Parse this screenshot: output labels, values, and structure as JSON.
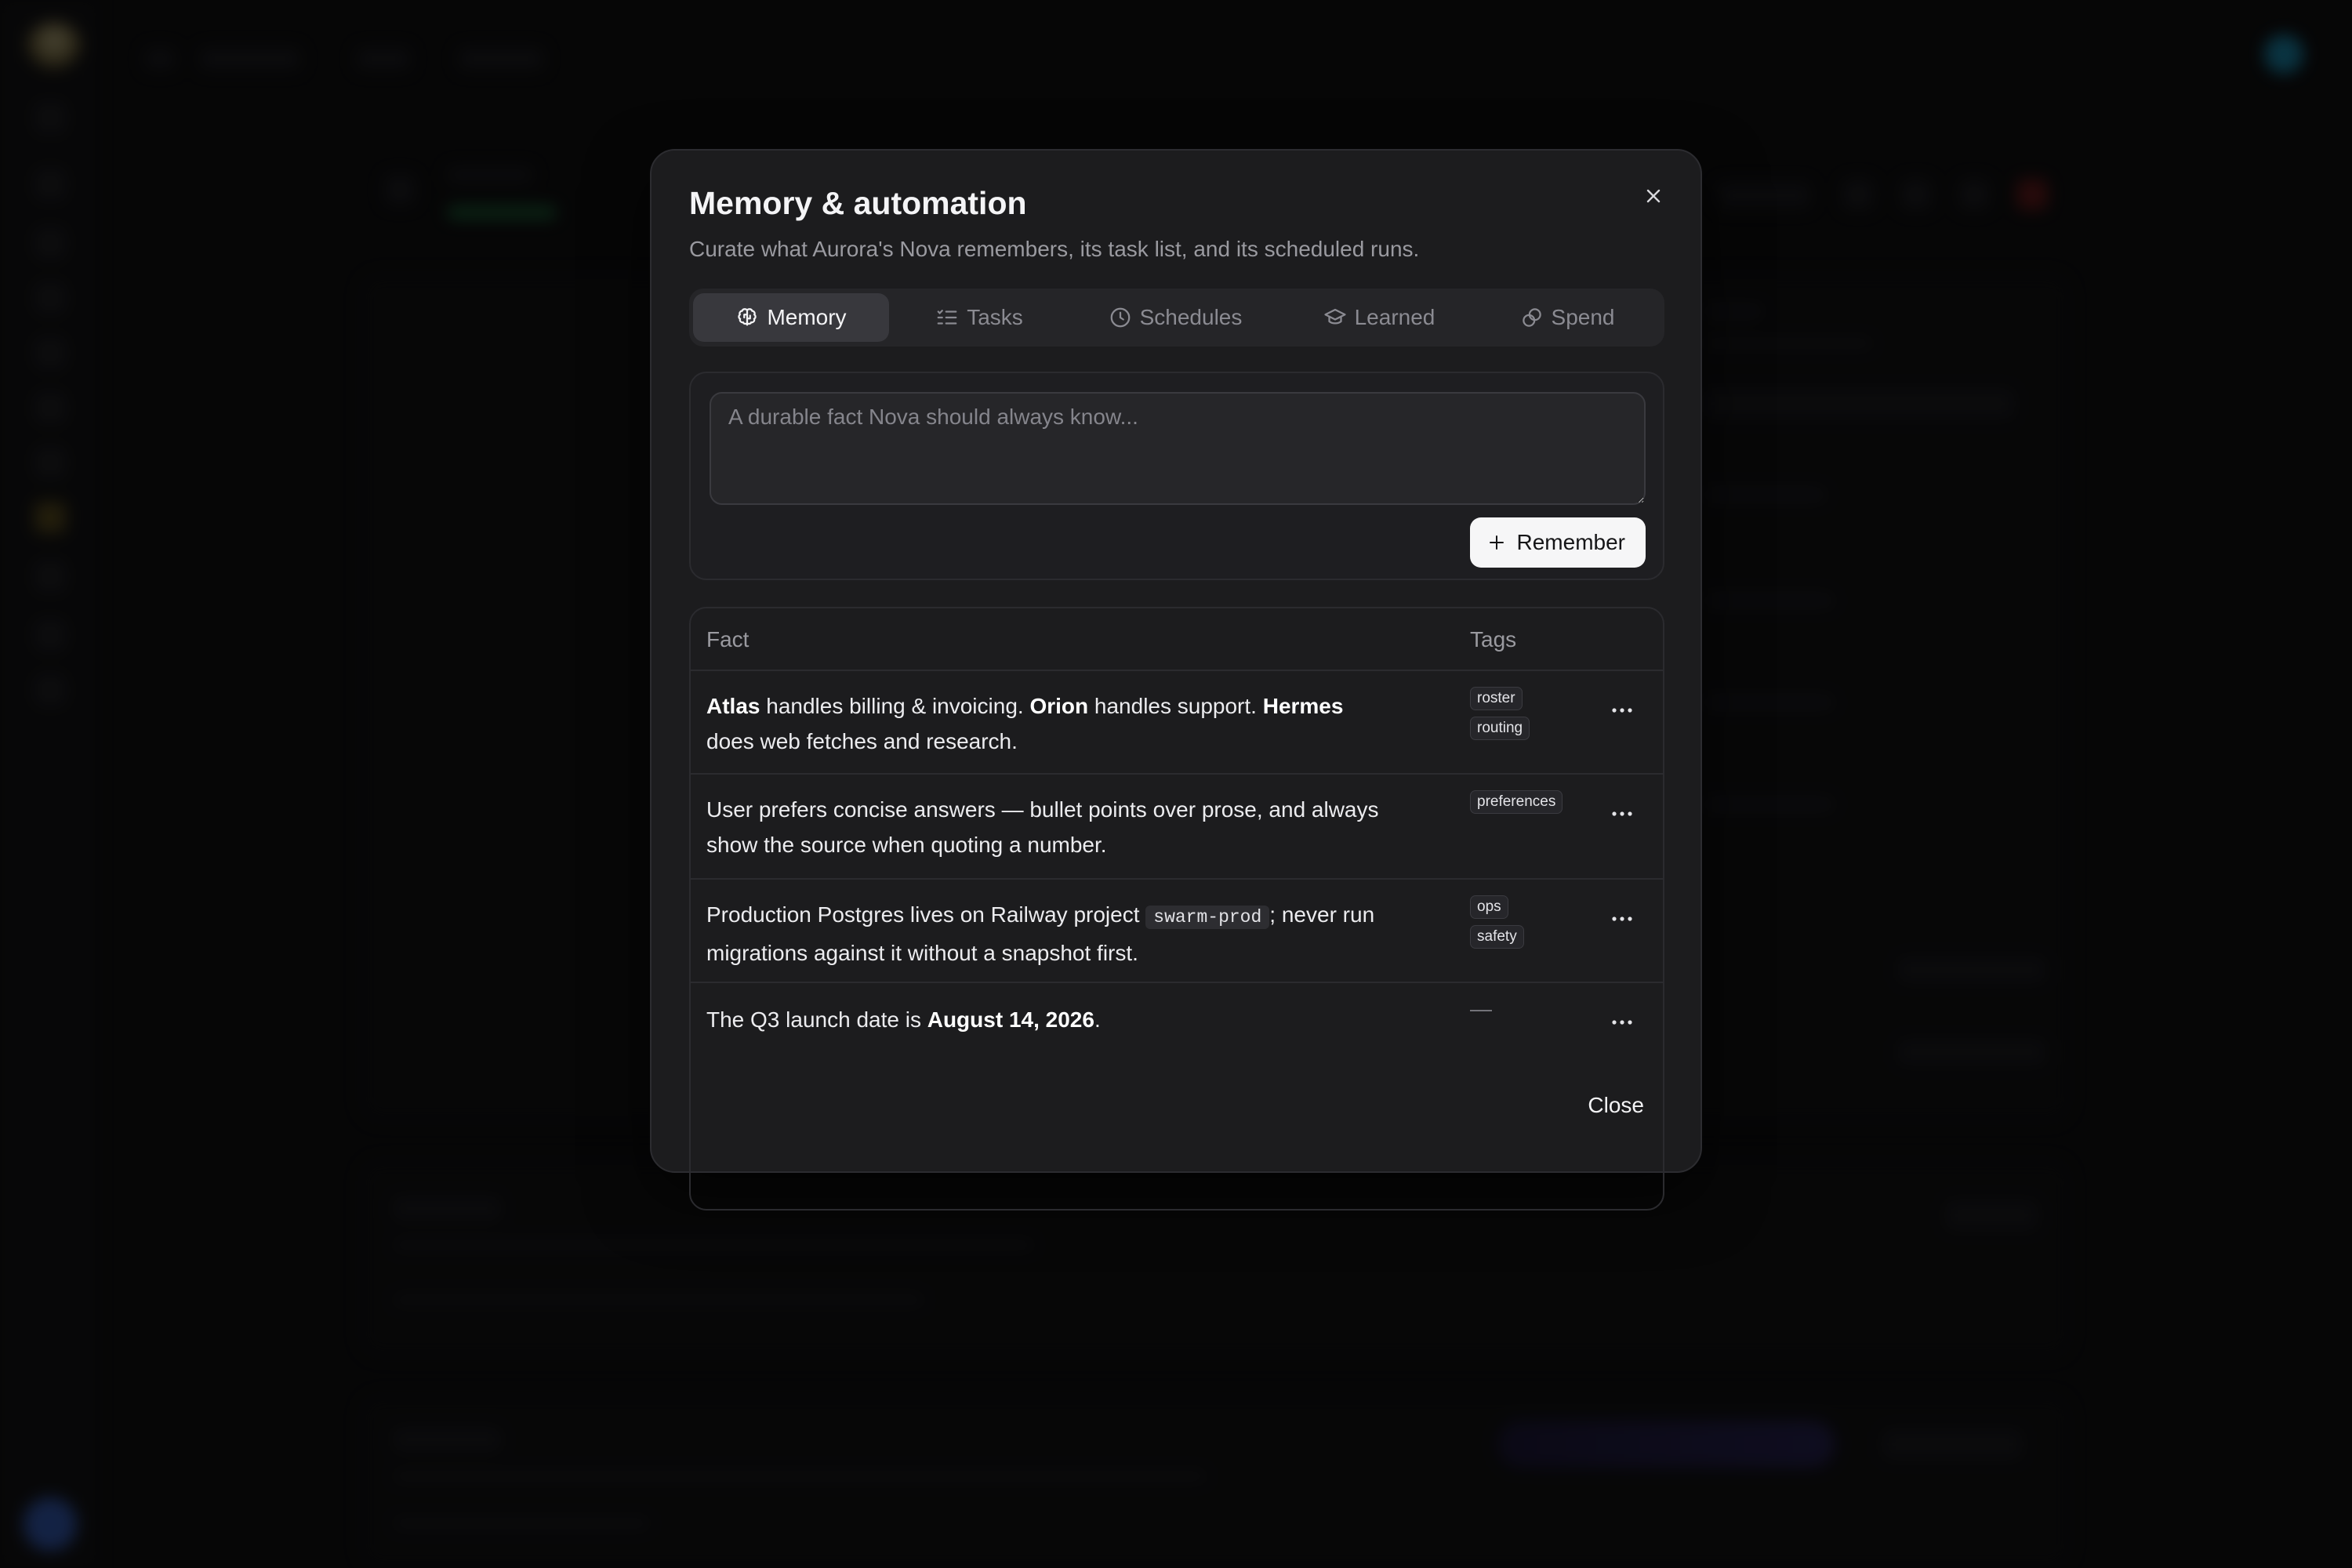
{
  "modal": {
    "title": "Memory & automation",
    "subtitle": "Curate what Aurora's Nova remembers, its task list, and its scheduled runs.",
    "close_icon": "close-icon",
    "footer_close_label": "Close"
  },
  "tabs": [
    {
      "label": "Memory",
      "icon": "brain-icon",
      "active": true
    },
    {
      "label": "Tasks",
      "icon": "checklist-icon",
      "active": false
    },
    {
      "label": "Schedules",
      "icon": "clock-icon",
      "active": false
    },
    {
      "label": "Learned",
      "icon": "graduation-cap-icon",
      "active": false
    },
    {
      "label": "Spend",
      "icon": "coins-icon",
      "active": false
    }
  ],
  "compose": {
    "placeholder": "A durable fact Nova should always know...",
    "value": "",
    "remember_label": "Remember"
  },
  "table": {
    "headers": {
      "fact": "Fact",
      "tags": "Tags"
    },
    "rows": [
      {
        "segments": [
          {
            "text": "Atlas",
            "style": "bold"
          },
          {
            "text": " handles billing & invoicing. ",
            "style": "plain"
          },
          {
            "text": "Orion",
            "style": "bold"
          },
          {
            "text": " handles support. ",
            "style": "plain"
          },
          {
            "text": "Hermes",
            "style": "bold"
          },
          {
            "text": " does web fetches and research.",
            "style": "plain"
          }
        ],
        "tags": [
          "roster",
          "routing"
        ]
      },
      {
        "segments": [
          {
            "text": "User prefers concise answers — bullet points over prose, and always show the source when quoting a number.",
            "style": "plain"
          }
        ],
        "tags": [
          "preferences"
        ]
      },
      {
        "segments": [
          {
            "text": "Production Postgres lives on Railway project ",
            "style": "plain"
          },
          {
            "text": "swarm-prod",
            "style": "code"
          },
          {
            "text": "; never run migrations against it without a snapshot first.",
            "style": "plain"
          }
        ],
        "tags": [
          "ops",
          "safety"
        ]
      },
      {
        "segments": [
          {
            "text": "The Q3 launch date is ",
            "style": "plain"
          },
          {
            "text": "August 14, 2026",
            "style": "bold"
          },
          {
            "text": ".",
            "style": "plain"
          }
        ],
        "tags": [],
        "empty_tags": "—"
      }
    ]
  },
  "colors": {
    "modal_bg": "#1c1c1e",
    "accent_button_bg": "#f6f6f7",
    "active_tab_bg": "#38383d"
  }
}
